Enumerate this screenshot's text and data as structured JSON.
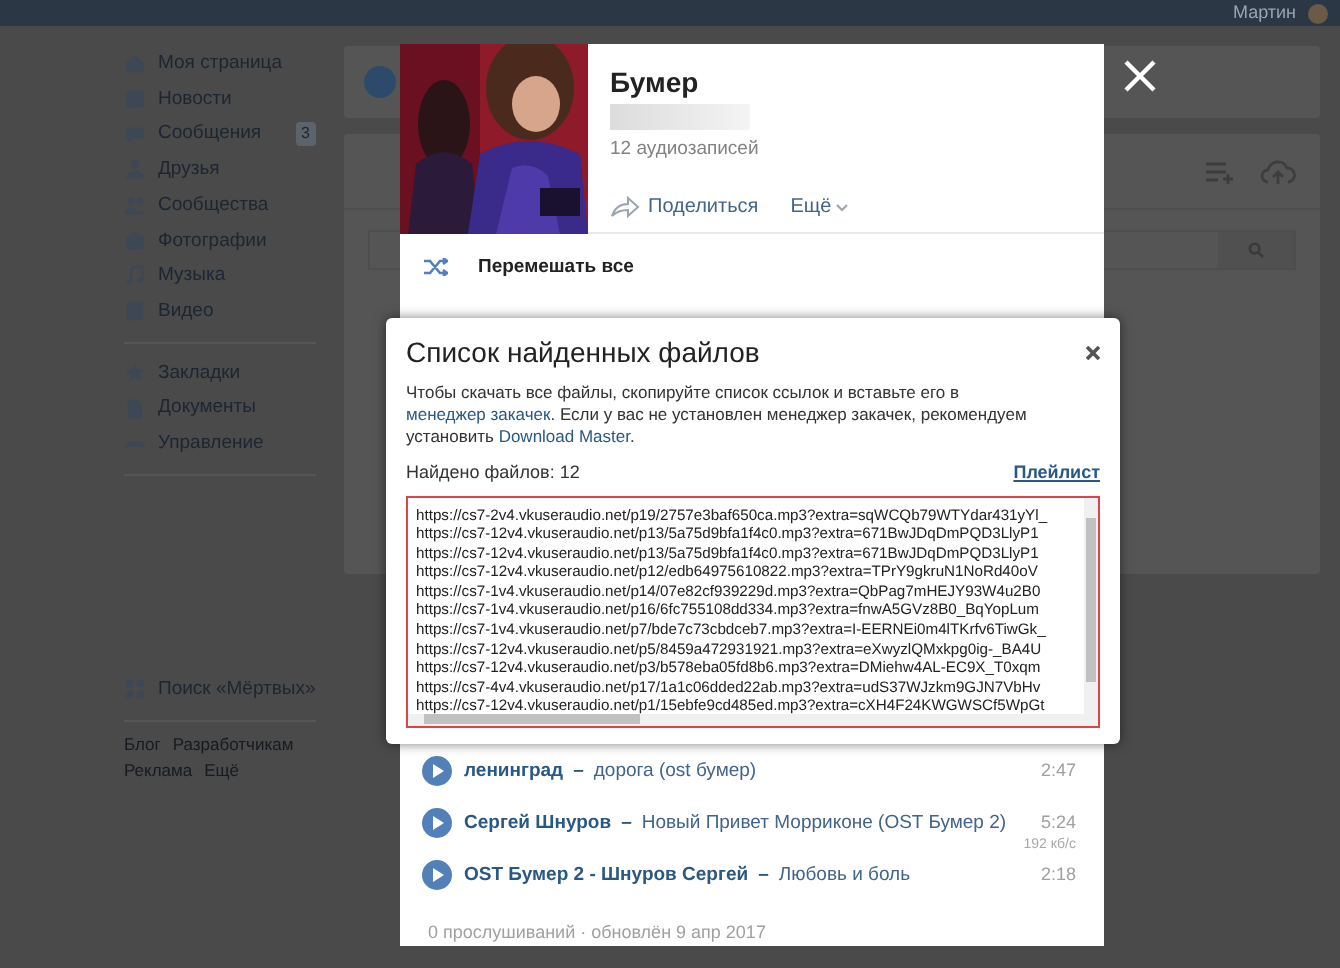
{
  "header": {
    "user_name": "Мартин"
  },
  "sidebar": {
    "items": [
      {
        "label": "Моя страница"
      },
      {
        "label": "Новости"
      },
      {
        "label": "Сообщения",
        "badge": "3"
      },
      {
        "label": "Друзья"
      },
      {
        "label": "Сообщества"
      },
      {
        "label": "Фотографии"
      },
      {
        "label": "Музыка"
      },
      {
        "label": "Видео"
      }
    ],
    "secondary_items": [
      {
        "label": "Закладки"
      },
      {
        "label": "Документы"
      },
      {
        "label": "Управление"
      }
    ],
    "app_item": {
      "label": "Поиск «Мёртвых»"
    },
    "footer_links": [
      "Блог",
      "Разработчикам",
      "Реклама",
      "Ещё"
    ]
  },
  "playlist": {
    "title": "Бумер",
    "count": "12 аудиозаписей",
    "share": "Поделиться",
    "more": "Ещё",
    "shuffle": "Перемешать все",
    "tracks": [
      {
        "artist": "ленинград",
        "separator": "–",
        "title": "дорога (ost бумер)",
        "duration": "2:47"
      },
      {
        "artist": "Сергей Шнуров",
        "separator": "–",
        "title": "Новый Привет Морриконе (OST Бумер 2)",
        "duration": "5:24",
        "bitrate": "192 кб/с"
      },
      {
        "artist": "OST Бумер 2 - Шнуров Сергей",
        "separator": "–",
        "title": "Любовь и боль",
        "duration": "2:18"
      }
    ],
    "footer": "0 прослушиваний · обновлён 9 апр 2017"
  },
  "dialog": {
    "title": "Список найденных файлов",
    "description": [
      {
        "kind": "text",
        "text": "Чтобы скачать все файлы, скопируйте список ссылок и вставьте его в "
      },
      {
        "kind": "link",
        "text": "менеджер закачек"
      },
      {
        "kind": "text",
        "text": ". Если у вас не установлен менеджер закачек, рекомендуем установить "
      },
      {
        "kind": "link",
        "text": "Download Master"
      },
      {
        "kind": "text",
        "text": "."
      }
    ],
    "found": "Найдено файлов: 12",
    "playlist_link": "Плейлист",
    "links": [
      "https://cs7-2v4.vkuseraudio.net/p19/2757e3baf650ca.mp3?extra=sqWCQb79WTYdar431yYl_",
      "https://cs7-12v4.vkuseraudio.net/p13/5a75d9bfa1f4c0.mp3?extra=671BwJDqDmPQD3LlyP1",
      "https://cs7-12v4.vkuseraudio.net/p13/5a75d9bfa1f4c0.mp3?extra=671BwJDqDmPQD3LlyP1",
      "https://cs7-12v4.vkuseraudio.net/p12/edb64975610822.mp3?extra=TPrY9gkruN1NoRd40oV",
      "https://cs7-1v4.vkuseraudio.net/p14/07e82cf939229d.mp3?extra=QbPag7mHEJY93W4u2B0",
      "https://cs7-1v4.vkuseraudio.net/p16/6fc755108dd334.mp3?extra=fnwA5GVz8B0_BqYopLum",
      "https://cs7-1v4.vkuseraudio.net/p7/bde7c73cbdceb7.mp3?extra=I-EERNEi0m4lTKrfv6TiwGk_",
      "https://cs7-12v4.vkuseraudio.net/p5/8459a472931921.mp3?extra=eXwyzlQMxkpg0ig-_BA4U",
      "https://cs7-12v4.vkuseraudio.net/p3/b578eba05fd8b6.mp3?extra=DMiehw4AL-EC9X_T0xqm",
      "https://cs7-4v4.vkuseraudio.net/p17/1a1c06dded22ab.mp3?extra=udS37WJzkm9GJN7VbHv",
      "https://cs7-12v4.vkuseraudio.net/p1/15ebfe9cd485ed.mp3?extra=cXH4F24KWGWSCf5WpGt"
    ]
  }
}
